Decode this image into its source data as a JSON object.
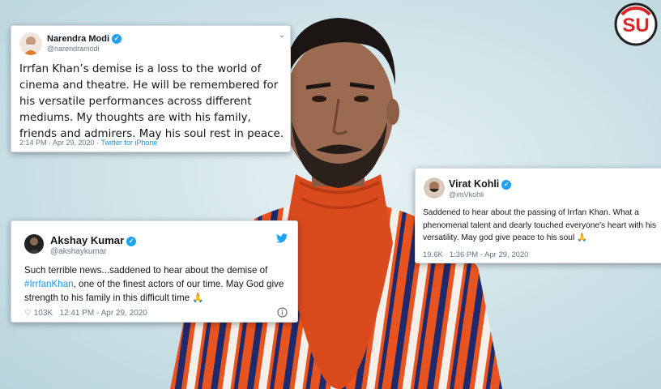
{
  "logo": {
    "text": "SU"
  },
  "tweets": {
    "modi": {
      "name": "Narendra Modi",
      "handle": "@narendramodi",
      "text": "Irrfan Khan’s demise is a loss to the world of cinema and theatre. He will be remembered for his versatile performances across different mediums. My thoughts are with his family, friends and admirers. May his soul rest in peace.",
      "time": "2:14 PM · Apr 29, 2020 · ",
      "source": "Twitter for iPhone"
    },
    "kohli": {
      "name": "Virat Kohli",
      "handle": "@imVkohli",
      "line1": "Saddened to hear about the passing of Irrfan Khan. What a",
      "line2": "phenomenal talent and dearly touched everyone's heart with his",
      "line3": "versatility. May god give peace to his soul 🙏",
      "likes": "19.6K",
      "time": "1:36 PM - Apr 29, 2020"
    },
    "akshay": {
      "name": "Akshay Kumar",
      "handle": "@akshaykumar",
      "text_before": "Such terrible news...saddened to hear about the demise of ",
      "hashtag": "#IrrfanKhan",
      "text_after": ", one of the finest actors of our time. May God give strength to his family in this difficult time 🙏",
      "likes": "103K",
      "time": "12:41 PM - Apr 29, 2020"
    }
  },
  "colors": {
    "twitter_blue": "#1da1f2",
    "jacket_orange": "#e8541f",
    "jacket_navy": "#1e2a6b"
  },
  "icons": [
    "verified-badge-icon",
    "chevron-down-icon",
    "twitter-bird-icon",
    "heart-icon",
    "info-icon"
  ]
}
